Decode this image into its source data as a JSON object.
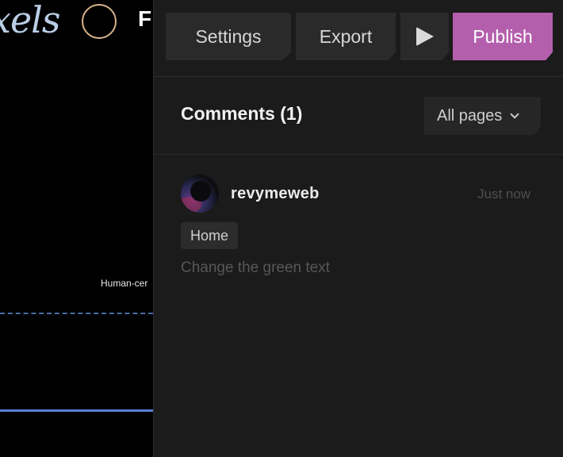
{
  "canvas": {
    "logo_text": "xels",
    "cut_letter": "F",
    "caption": "Human-cer"
  },
  "toolbar": {
    "settings_label": "Settings",
    "export_label": "Export",
    "play_icon": "play-icon",
    "publish_label": "Publish",
    "publish_color": "#b45fae"
  },
  "comments": {
    "title": "Comments (1)",
    "filter_label": "All pages",
    "filter_icon": "chevron-down-icon",
    "items": [
      {
        "username": "revymeweb",
        "timestamp": "Just now",
        "page": "Home",
        "text": "Change the green text"
      }
    ]
  }
}
